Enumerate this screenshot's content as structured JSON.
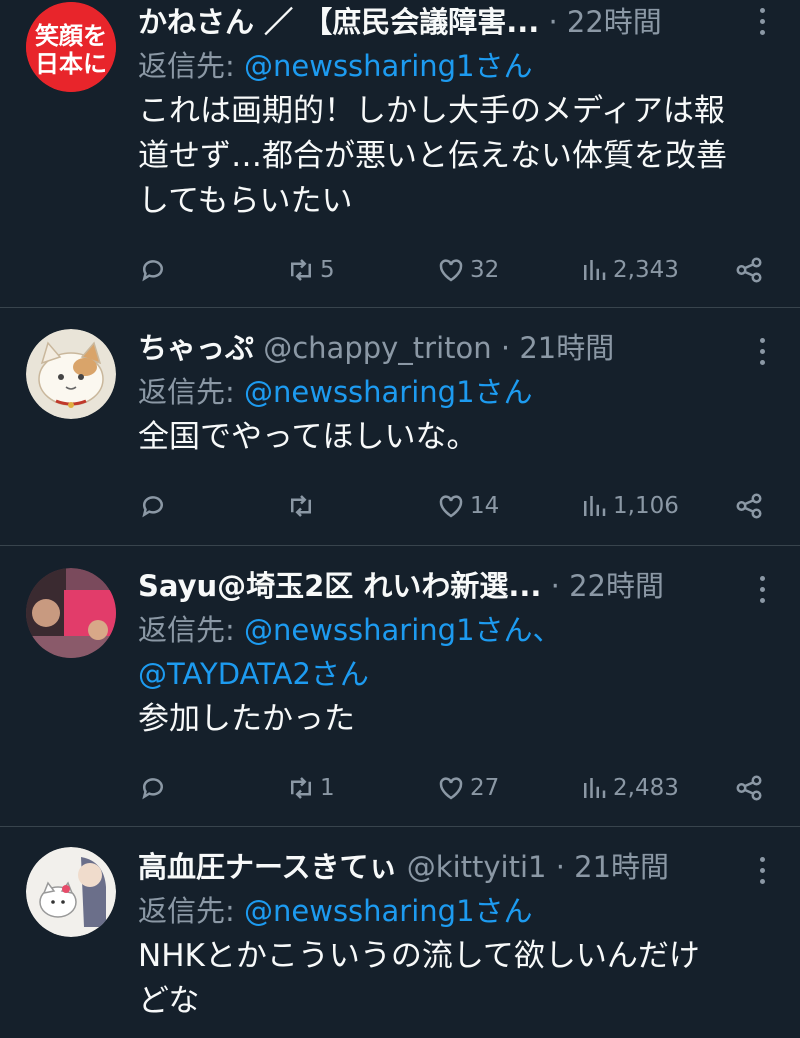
{
  "tweets": [
    {
      "name": "かねさん ／ 【庶民会議障害...",
      "handle": "",
      "time": "22時間",
      "reply_prefix": "返信先: ",
      "reply_to": "@newssharing1さん",
      "reply_to_2": "",
      "text": "これは画期的！しかし大手のメディアは報道せず…都合が悪いと伝えない体質を改善してもらいたい",
      "replies": "",
      "retweets": "5",
      "likes": "32",
      "views": "2,343",
      "avatar_text": "笑顔を日本に"
    },
    {
      "name": "ちゃっぷ",
      "handle": "@chappy_triton",
      "time": "21時間",
      "reply_prefix": "返信先: ",
      "reply_to": "@newssharing1さん",
      "reply_to_2": "",
      "text": "全国でやってほしいな。",
      "replies": "",
      "retweets": "",
      "likes": "14",
      "views": "1,106"
    },
    {
      "name": "Sayu@埼玉2区 れいわ新選...",
      "handle": "",
      "time": "22時間",
      "reply_prefix": "返信先: ",
      "reply_to": "@newssharing1さん、",
      "reply_to_2": "@TAYDATA2さん",
      "text": "参加したかった",
      "replies": "",
      "retweets": "1",
      "likes": "27",
      "views": "2,483"
    },
    {
      "name": "高血圧ナースきてぃ",
      "handle": "@kittyiti1",
      "time": "21時間",
      "reply_prefix": "返信先: ",
      "reply_to": "@newssharing1さん",
      "reply_to_2": "",
      "text": "NHKとかこういうの流して欲しいんだけどな"
    }
  ],
  "icons": [
    "reply-icon",
    "retweet-icon",
    "like-icon",
    "views-icon",
    "share-icon",
    "more-icon"
  ],
  "colors": {
    "background": "#15202b",
    "link": "#1d9bf0",
    "muted": "#8b98a5",
    "text": "#f7f9f9",
    "divider": "#38444d"
  }
}
